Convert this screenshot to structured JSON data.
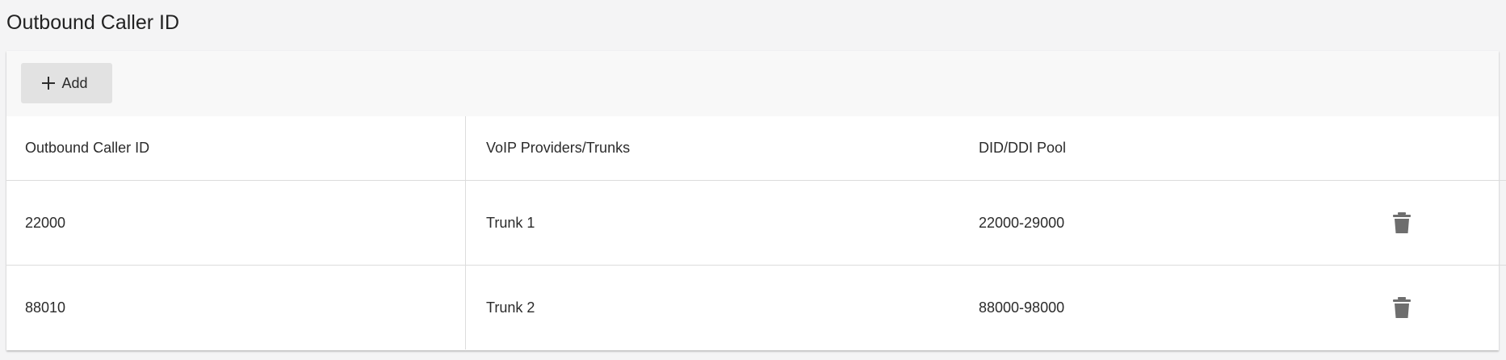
{
  "page": {
    "title": "Outbound Caller ID"
  },
  "toolbar": {
    "add_label": "Add",
    "add_icon": "plus-icon"
  },
  "table": {
    "headers": {
      "caller_id": "Outbound Caller ID",
      "trunks": "VoIP Providers/Trunks",
      "pool": "DID/DDI Pool"
    },
    "rows": [
      {
        "caller_id": "22000",
        "trunk": "Trunk 1",
        "pool": "22000-29000",
        "action_icon": "trash-icon"
      },
      {
        "caller_id": "88010",
        "trunk": "Trunk 2",
        "pool": "88000-98000",
        "action_icon": "trash-icon"
      }
    ]
  },
  "colors": {
    "background": "#f4f4f5",
    "toolbar": "#f8f8f8",
    "button": "#e2e2e2",
    "icon": "#6e6e6e",
    "divider": "#dcdcdc"
  }
}
